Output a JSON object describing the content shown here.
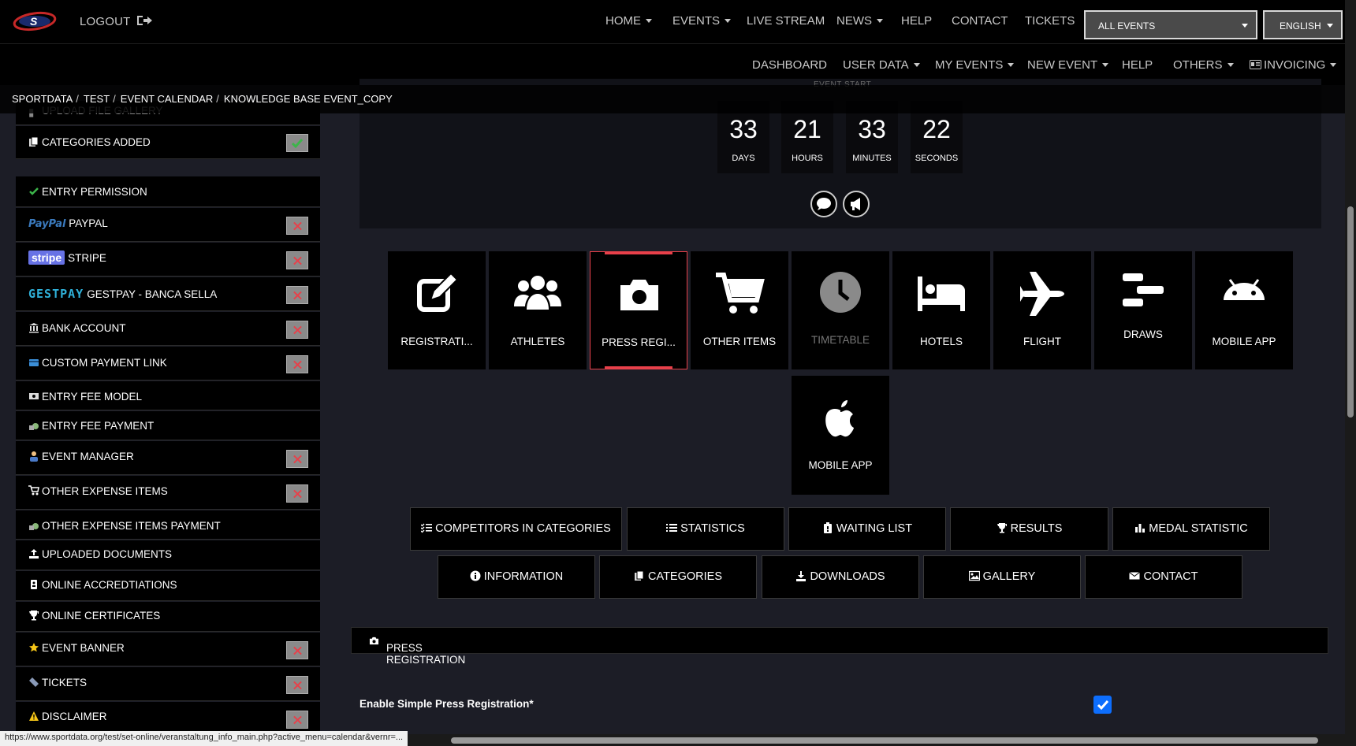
{
  "header": {
    "logout_label": "LOGOUT",
    "nav_primary": [
      {
        "label": "HOME",
        "dropdown": true
      },
      {
        "label": "EVENTS",
        "dropdown": true
      },
      {
        "label": "LIVE STREAM",
        "dropdown": false
      },
      {
        "label": "NEWS",
        "dropdown": true
      },
      {
        "label": "HELP",
        "dropdown": false
      },
      {
        "label": "CONTACT",
        "dropdown": false
      },
      {
        "label": "TICKETS",
        "dropdown": false
      }
    ],
    "events_select": "ALL EVENTS",
    "language_select": "ENGLISH",
    "nav_secondary": [
      {
        "label": "DASHBOARD",
        "dropdown": false
      },
      {
        "label": "USER DATA",
        "dropdown": true
      },
      {
        "label": "MY EVENTS",
        "dropdown": true
      },
      {
        "label": "NEW EVENT",
        "dropdown": true
      },
      {
        "label": "HELP",
        "dropdown": false
      },
      {
        "label": "OTHERS",
        "dropdown": true
      },
      {
        "label": "INVOICING",
        "dropdown": true
      }
    ]
  },
  "breadcrumb": [
    "SPORTDATA",
    "TEST",
    "EVENT CALENDAR",
    "KNOWLEDGE BASE EVENT_COPY"
  ],
  "sidebar": {
    "items": [
      {
        "label": "UPLOAD FILE GALLERY",
        "icon": "file-icon",
        "status": "none"
      },
      {
        "label": "CATEGORIES ADDED",
        "icon": "copy-icon",
        "status": "ok"
      },
      {
        "label": "ENTRY PERMISSION",
        "icon": "check-icon",
        "status": "none"
      },
      {
        "label": "PAYPAL",
        "brand": "PayPal",
        "icon": "paypal-logo",
        "status": "error"
      },
      {
        "label": "STRIPE",
        "brand": "stripe",
        "icon": "stripe-logo",
        "status": "error"
      },
      {
        "label": "GESTPAY - BANCA SELLA",
        "brand": "GESTPAY",
        "icon": "gestpay-logo",
        "status": "error"
      },
      {
        "label": "BANK ACCOUNT",
        "icon": "bank-icon",
        "status": "error"
      },
      {
        "label": "CUSTOM PAYMENT LINK",
        "icon": "card-icon",
        "status": "error"
      },
      {
        "label": "ENTRY FEE MODEL",
        "icon": "money-icon",
        "status": "none"
      },
      {
        "label": "ENTRY FEE PAYMENT",
        "icon": "money-bag-icon",
        "status": "none"
      },
      {
        "label": "EVENT MANAGER",
        "icon": "manager-icon",
        "status": "error"
      },
      {
        "label": "OTHER EXPENSE ITEMS",
        "icon": "cart-icon",
        "status": "error"
      },
      {
        "label": "OTHER EXPENSE ITEMS PAYMENT",
        "icon": "money-bag-icon",
        "status": "none"
      },
      {
        "label": "UPLOADED DOCUMENTS",
        "icon": "upload-icon",
        "status": "none"
      },
      {
        "label": "ONLINE ACCREDTIATIONS",
        "icon": "badge-icon",
        "status": "none"
      },
      {
        "label": "ONLINE CERTIFICATES",
        "icon": "trophy-icon",
        "status": "none"
      },
      {
        "label": "EVENT BANNER",
        "icon": "star-icon",
        "status": "error"
      },
      {
        "label": "TICKETS",
        "icon": "ticket-icon",
        "status": "error"
      },
      {
        "label": "DISCLAIMER",
        "icon": "warning-icon",
        "status": "error"
      }
    ]
  },
  "countdown": {
    "label": "EVENT START",
    "units": [
      {
        "value": "33",
        "label": "DAYS"
      },
      {
        "value": "21",
        "label": "HOURS"
      },
      {
        "value": "33",
        "label": "MINUTES"
      },
      {
        "value": "22",
        "label": "SECONDS"
      }
    ]
  },
  "tiles": [
    {
      "label": "REGISTRATI...",
      "icon": "edit-icon",
      "active": false,
      "disabled": false
    },
    {
      "label": "ATHLETES",
      "icon": "users-icon",
      "active": false,
      "disabled": false
    },
    {
      "label": "PRESS REGI...",
      "icon": "camera-icon",
      "active": true,
      "disabled": false
    },
    {
      "label": "OTHER ITEMS",
      "icon": "cart-icon",
      "active": false,
      "disabled": false
    },
    {
      "label": "TIMETABLE",
      "icon": "clock-icon",
      "active": false,
      "disabled": true
    },
    {
      "label": "HOTELS",
      "icon": "bed-icon",
      "active": false,
      "disabled": false
    },
    {
      "label": "FLIGHT",
      "icon": "plane-icon",
      "active": false,
      "disabled": false
    },
    {
      "label": "DRAWS",
      "icon": "draws-icon",
      "active": false,
      "disabled": false
    },
    {
      "label": "MOBILE APP",
      "icon": "android-icon",
      "active": false,
      "disabled": false
    },
    {
      "label": "MOBILE APP",
      "icon": "apple-icon",
      "active": false,
      "disabled": false
    }
  ],
  "action_buttons_row1": [
    {
      "label": "COMPETITORS IN CATEGORIES",
      "icon": "list-check-icon"
    },
    {
      "label": "STATISTICS",
      "icon": "list-icon"
    },
    {
      "label": "WAITING LIST",
      "icon": "clipboard-icon"
    },
    {
      "label": "RESULTS",
      "icon": "trophy-icon"
    },
    {
      "label": "MEDAL STATISTIC",
      "icon": "bar-chart-icon"
    }
  ],
  "action_buttons_row2": [
    {
      "label": "INFORMATION",
      "icon": "info-icon"
    },
    {
      "label": "CATEGORIES",
      "icon": "copy-icon"
    },
    {
      "label": "DOWNLOADS",
      "icon": "download-icon"
    },
    {
      "label": "GALLERY",
      "icon": "image-icon"
    },
    {
      "label": "CONTACT",
      "icon": "envelope-icon"
    }
  ],
  "press_section": {
    "title": "PRESS REGISTRATION",
    "enable_label": "Enable Simple Press Registration*",
    "enable_checked": true
  },
  "status_bar": {
    "url": "https://www.sportdata.org/test/set-online/veranstaltung_info_main.php?active_menu=calendar&vernr=..."
  },
  "colors": {
    "accent": "#e8404a",
    "checkbox": "#0d6efd",
    "background": "#1c1d26",
    "panel": "#000000"
  }
}
